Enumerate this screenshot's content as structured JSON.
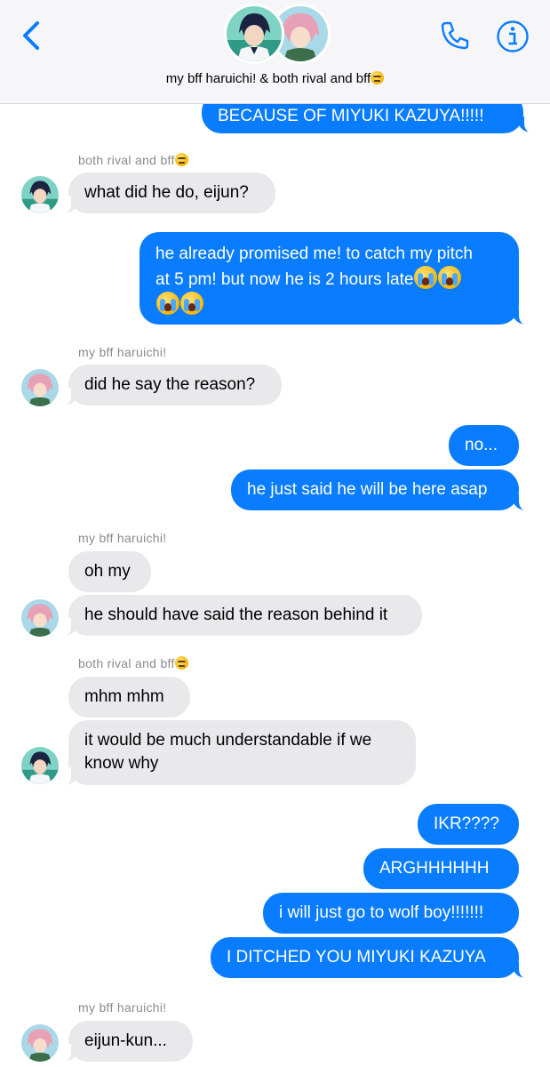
{
  "header": {
    "group_name": "my bff haruichi! & both rival and bff",
    "icons": {
      "back": "chevron-left-icon",
      "phone": "phone-icon",
      "info": "info-icon"
    },
    "accent_color": "#0a7cff"
  },
  "senders": {
    "rival": "both rival and bff",
    "haruichi": "my bff haruichi!"
  },
  "messages": {
    "m0": "BECAUSE OF MIYUKI KAZUYA!!!!!",
    "m1": "what did he do, eijun?",
    "m2a": "he already promised me! to catch my pitch",
    "m2b": "at 5 pm! but now he is 2 hours late",
    "m3": "did he say the reason?",
    "m4": "no...",
    "m5": "he just said he will be here asap",
    "m6": "oh my",
    "m7": "he should have said the reason behind it",
    "m8": "mhm mhm",
    "m9a": "it would be much understandable if we",
    "m9b": "know why",
    "m10": "IKR????",
    "m11": "ARGHHHHHH",
    "m12": "i will just go to wolf boy!!!!!!!",
    "m13": "I DITCHED YOU MIYUKI KAZUYA",
    "m14": "eijun-kun..."
  },
  "colors": {
    "outgoing_bubble": "#0a7cff",
    "incoming_bubble": "#e9e9eb",
    "sender_label": "#8a8a8e"
  }
}
